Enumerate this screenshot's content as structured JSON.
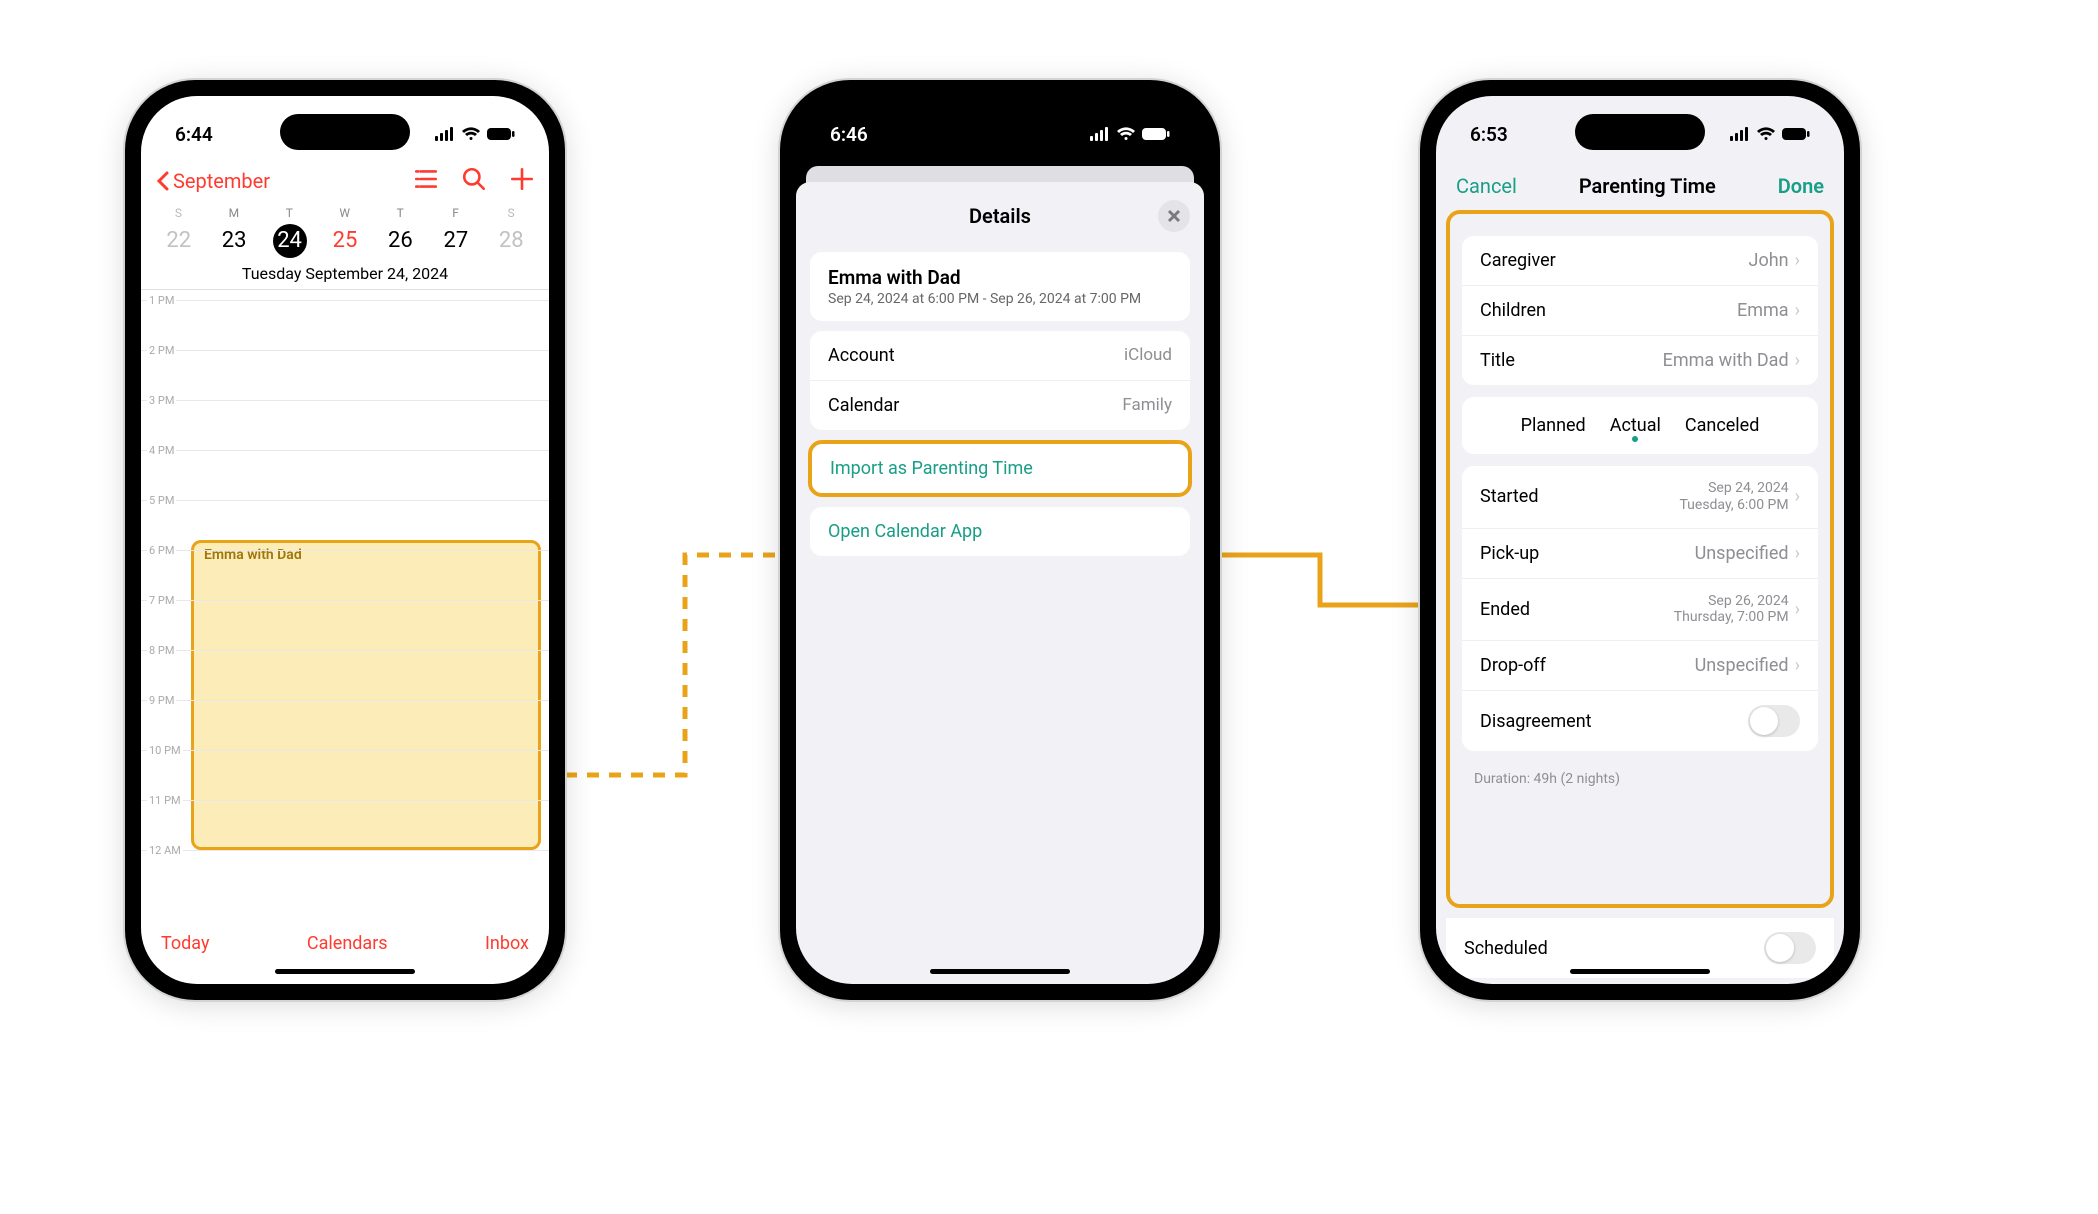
{
  "colors": {
    "accent_red": "#ff3b30",
    "accent_teal": "#199e87",
    "highlight_orange": "#e9a319"
  },
  "phone1": {
    "status_time": "6:44",
    "nav_back_label": "September",
    "week_labels": [
      "S",
      "M",
      "T",
      "W",
      "T",
      "F",
      "S"
    ],
    "days": [
      {
        "n": "22",
        "style": "dim"
      },
      {
        "n": "23",
        "style": ""
      },
      {
        "n": "24",
        "style": "active"
      },
      {
        "n": "25",
        "style": "red"
      },
      {
        "n": "26",
        "style": ""
      },
      {
        "n": "27",
        "style": ""
      },
      {
        "n": "28",
        "style": "dim"
      }
    ],
    "date_full": "Tuesday  September 24, 2024",
    "hours": [
      "1 PM",
      "2 PM",
      "3 PM",
      "4 PM",
      "5 PM",
      "6 PM",
      "7 PM",
      "8 PM",
      "9 PM",
      "10 PM",
      "11 PM",
      "12 AM"
    ],
    "event_title": "Emma with Dad",
    "footer": {
      "today": "Today",
      "calendars": "Calendars",
      "inbox": "Inbox"
    }
  },
  "phone2": {
    "status_time": "6:46",
    "sheet_title": "Details",
    "event_title": "Emma with Dad",
    "event_range": "Sep 24, 2024 at 6:00 PM - Sep 26, 2024 at 7:00 PM",
    "account_label": "Account",
    "account_value": "iCloud",
    "calendar_label": "Calendar",
    "calendar_value": "Family",
    "import_action": "Import as Parenting Time",
    "open_action": "Open Calendar App"
  },
  "phone3": {
    "status_time": "6:53",
    "cancel": "Cancel",
    "title": "Parenting Time",
    "done": "Done",
    "caregiver_label": "Caregiver",
    "caregiver_value": "John",
    "children_label": "Children",
    "children_value": "Emma",
    "title_label": "Title",
    "title_value": "Emma with Dad",
    "segments": [
      "Planned",
      "Actual",
      "Canceled"
    ],
    "segment_active_index": 1,
    "started_label": "Started",
    "started_value_line1": "Sep 24, 2024",
    "started_value_line2": "Tuesday, 6:00 PM",
    "pickup_label": "Pick-up",
    "pickup_value": "Unspecified",
    "ended_label": "Ended",
    "ended_value_line1": "Sep 26, 2024",
    "ended_value_line2": "Thursday, 7:00 PM",
    "dropoff_label": "Drop-off",
    "dropoff_value": "Unspecified",
    "disagreement_label": "Disagreement",
    "duration_note": "Duration: 49h (2 nights)",
    "scheduled_label": "Scheduled"
  }
}
